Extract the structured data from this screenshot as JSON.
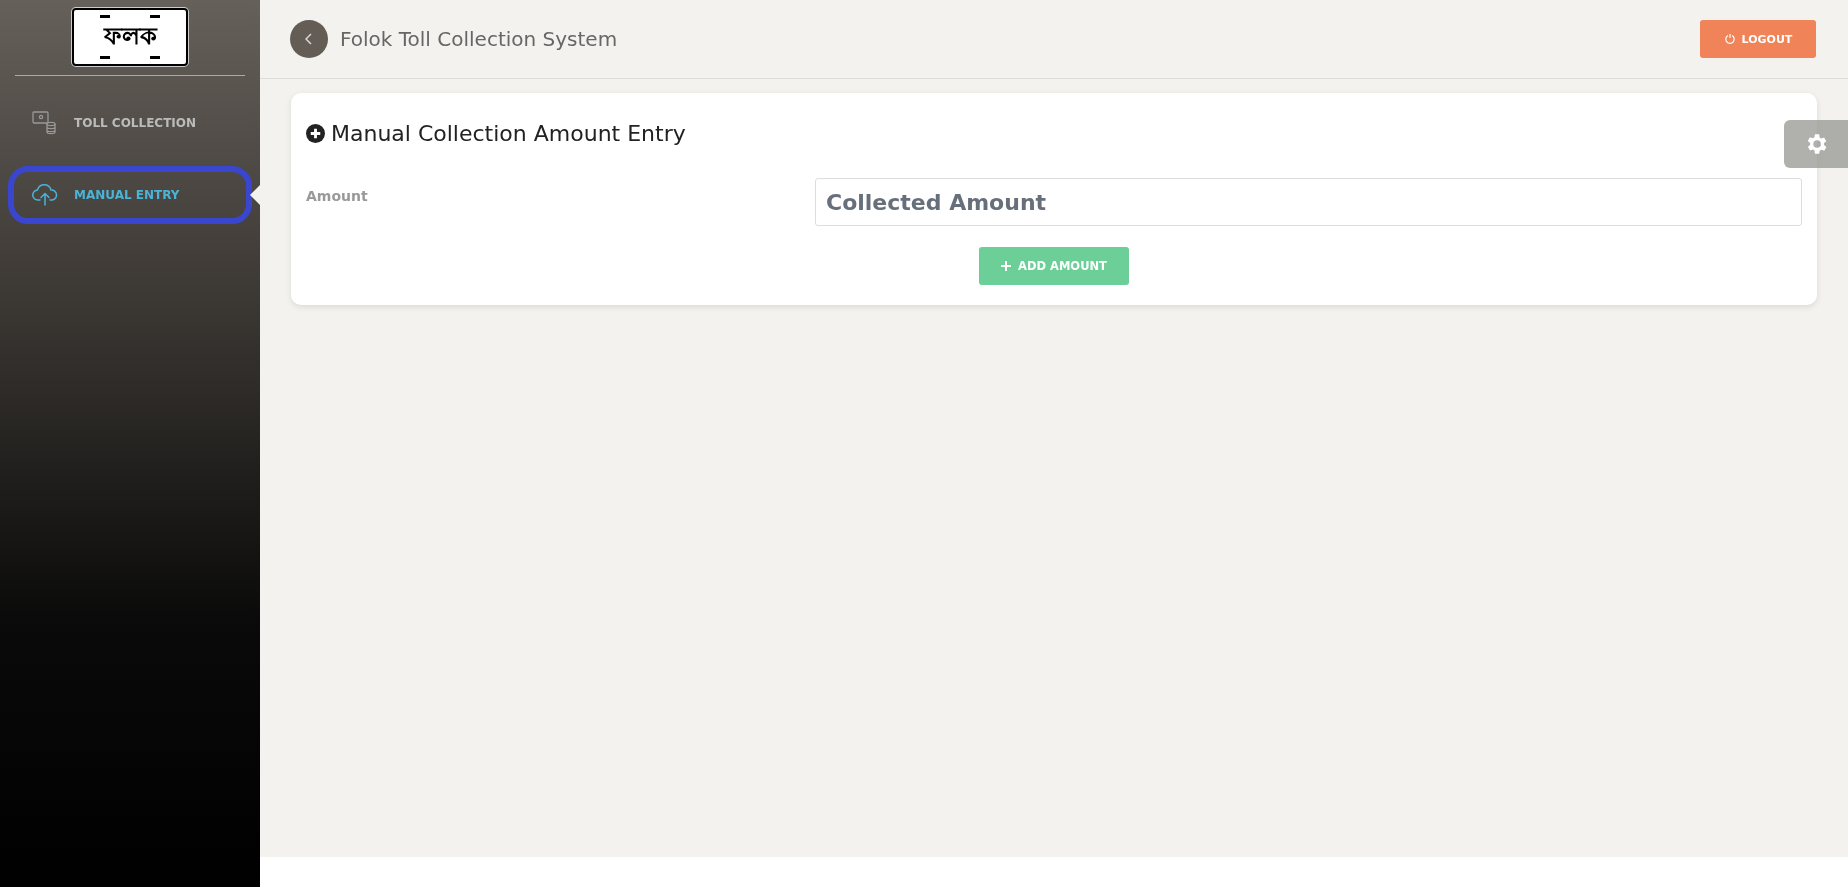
{
  "logo": {
    "text": "ফলক"
  },
  "sidebar": {
    "items": [
      {
        "label": "TOLL COLLECTION",
        "kind": "toll",
        "selected": false
      },
      {
        "label": "MANUAL ENTRY",
        "kind": "upload",
        "selected": true
      }
    ]
  },
  "header": {
    "title": "Folok Toll Collection System",
    "logout": "LOGOUT"
  },
  "card": {
    "title": "Manual Collection Amount Entry",
    "field_label": "Amount",
    "field": {
      "placeholder": "Collected Amount"
    },
    "button": "ADD AMOUNT"
  }
}
